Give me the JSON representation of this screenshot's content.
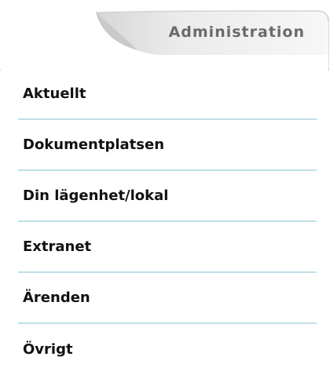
{
  "header": {
    "title": "Administration"
  },
  "menu": {
    "items": [
      {
        "label": "Aktuellt"
      },
      {
        "label": "Dokumentplatsen"
      },
      {
        "label": "Din lägenhet/lokal"
      },
      {
        "label": "Extranet"
      },
      {
        "label": "Ärenden"
      },
      {
        "label": "Övrigt"
      }
    ]
  },
  "colors": {
    "divider": "#bfdfe6",
    "tab_gradient_light": "#ffffff",
    "tab_gradient_dark": "#d9d9d9",
    "tab_text": "#6a6a6a",
    "menu_text": "#111111"
  }
}
